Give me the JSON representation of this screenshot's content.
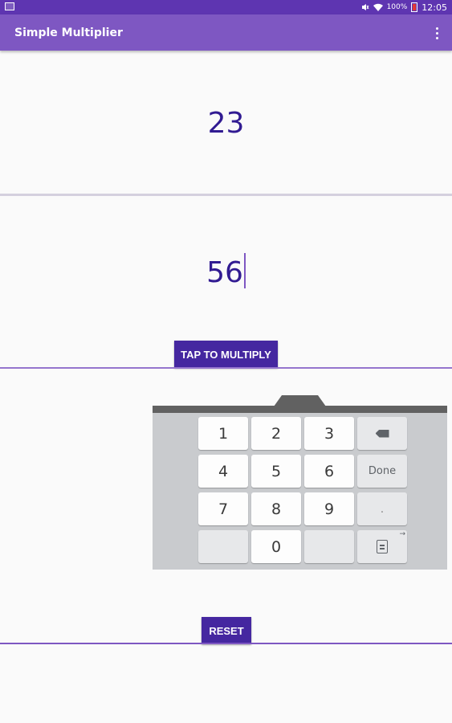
{
  "status_bar": {
    "battery": "100%",
    "time": "12:05",
    "icons": [
      "notification-icon",
      "mute-icon",
      "wifi-icon",
      "battery-icon"
    ]
  },
  "app_bar": {
    "title": "Simple Multiplier",
    "menu_icon": "overflow-menu-icon"
  },
  "fields": {
    "first_number": "23",
    "second_number": "56"
  },
  "buttons": {
    "multiply": "TAP TO MULTIPLY",
    "reset": "RESET"
  },
  "keyboard": {
    "keys": {
      "k1": "1",
      "k2": "2",
      "k3": "3",
      "k4": "4",
      "k5": "5",
      "k6": "6",
      "k7": "7",
      "k8": "8",
      "k9": "9",
      "k0": "0",
      "done": "Done",
      "dot": "."
    },
    "icons": [
      "backspace-icon",
      "clipboard-icon"
    ]
  },
  "colors": {
    "status_bar": "#5e35b1",
    "app_bar": "#7e57c2",
    "button": "#4527a0",
    "number_text": "#311b92"
  }
}
